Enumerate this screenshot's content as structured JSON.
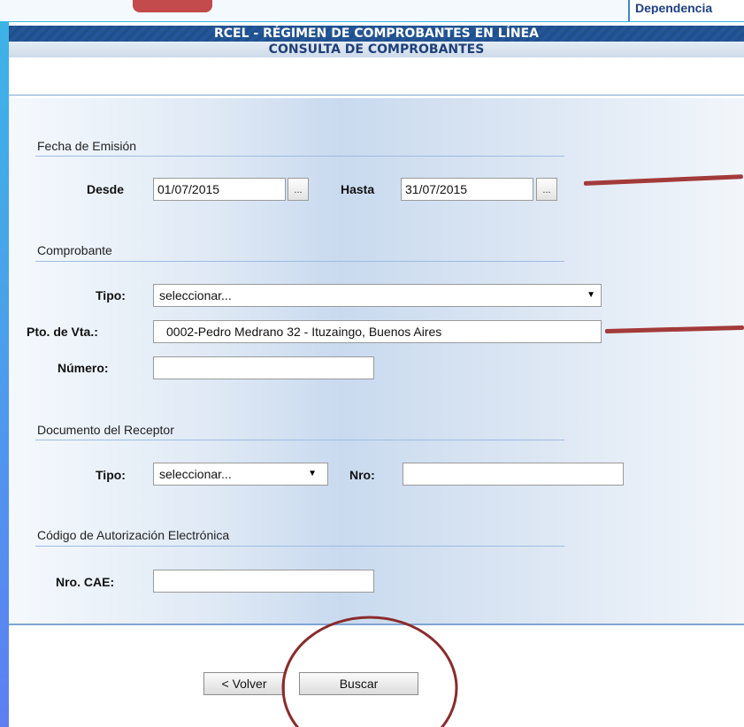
{
  "top": {
    "dependency_label": "Dependencia"
  },
  "header": {
    "title": "RCEL - RÉGIMEN DE COMPROBANTES EN LÍNEA",
    "subtitle": "CONSULTA DE COMPROBANTES"
  },
  "fecha": {
    "section": "Fecha de Emisión",
    "desde_label": "Desde",
    "desde_value": "01/07/2015",
    "hasta_label": "Hasta",
    "hasta_value": "31/07/2015",
    "picker_label": "..."
  },
  "comprobante": {
    "section": "Comprobante",
    "tipo_label": "Tipo:",
    "tipo_value": "seleccionar...",
    "pto_label": "Pto. de Vta.:",
    "pto_value": "0002-Pedro Medrano 32 - Ituzaingo, Buenos Aires",
    "numero_label": "Número:",
    "numero_value": ""
  },
  "receptor": {
    "section": "Documento del Receptor",
    "tipo_label": "Tipo:",
    "tipo_value": "seleccionar...",
    "nro_label": "Nro:",
    "nro_value": ""
  },
  "cae": {
    "section": "Código de Autorización Electrónica",
    "nro_label": "Nro. CAE:",
    "nro_value": ""
  },
  "buttons": {
    "volver": "< Volver",
    "buscar": "Buscar"
  },
  "icons": {
    "dropdown": "▼"
  },
  "colors": {
    "header_bar": "#1f4f8c",
    "annotation": "#a33a3a"
  }
}
